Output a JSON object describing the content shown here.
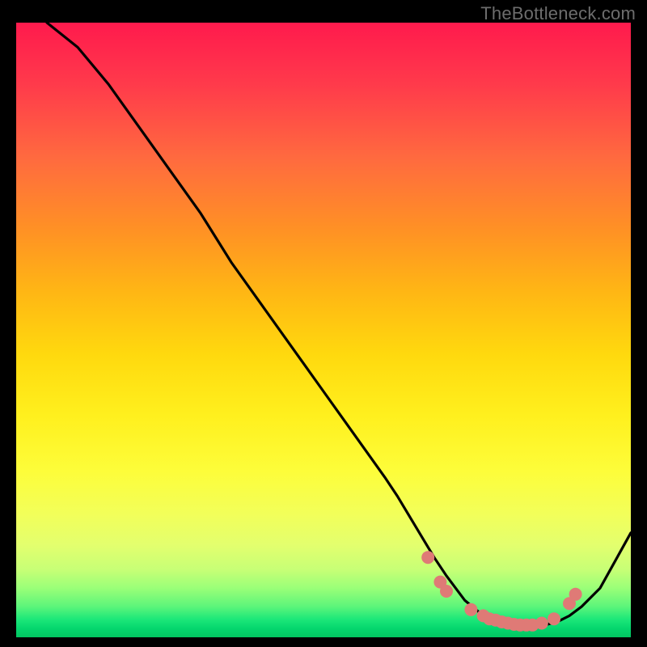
{
  "attribution": "TheBottleneck.com",
  "chart_data": {
    "type": "line",
    "title": "",
    "xlabel": "",
    "ylabel": "",
    "xlim": [
      0,
      100
    ],
    "ylim": [
      0,
      100
    ],
    "grid": false,
    "background": "red-yellow-green vertical gradient",
    "series": [
      {
        "name": "bottleneck-curve",
        "x": [
          5,
          10,
          15,
          20,
          25,
          30,
          35,
          40,
          45,
          50,
          55,
          60,
          62,
          65,
          68,
          70,
          73,
          76,
          78,
          80,
          82,
          84,
          86,
          88,
          90,
          92,
          95,
          100
        ],
        "y": [
          100,
          96,
          90,
          83,
          76,
          69,
          61,
          54,
          47,
          40,
          33,
          26,
          23,
          18,
          13,
          10,
          6,
          3.5,
          2.5,
          2,
          1.8,
          1.8,
          2,
          2.5,
          3.5,
          5,
          8,
          17
        ]
      }
    ],
    "markers": [
      {
        "name": "highlight-dots",
        "color": "#df7a76",
        "points": [
          {
            "x": 67,
            "y": 13
          },
          {
            "x": 69,
            "y": 9
          },
          {
            "x": 70,
            "y": 7.5
          },
          {
            "x": 74,
            "y": 4.5
          },
          {
            "x": 76,
            "y": 3.5
          },
          {
            "x": 77,
            "y": 3
          },
          {
            "x": 78,
            "y": 2.8
          },
          {
            "x": 79,
            "y": 2.5
          },
          {
            "x": 80,
            "y": 2.3
          },
          {
            "x": 81,
            "y": 2.1
          },
          {
            "x": 82,
            "y": 2
          },
          {
            "x": 83,
            "y": 2
          },
          {
            "x": 84,
            "y": 2
          },
          {
            "x": 85.5,
            "y": 2.3
          },
          {
            "x": 87.5,
            "y": 3
          },
          {
            "x": 90,
            "y": 5.5
          },
          {
            "x": 91,
            "y": 7
          }
        ]
      }
    ]
  }
}
